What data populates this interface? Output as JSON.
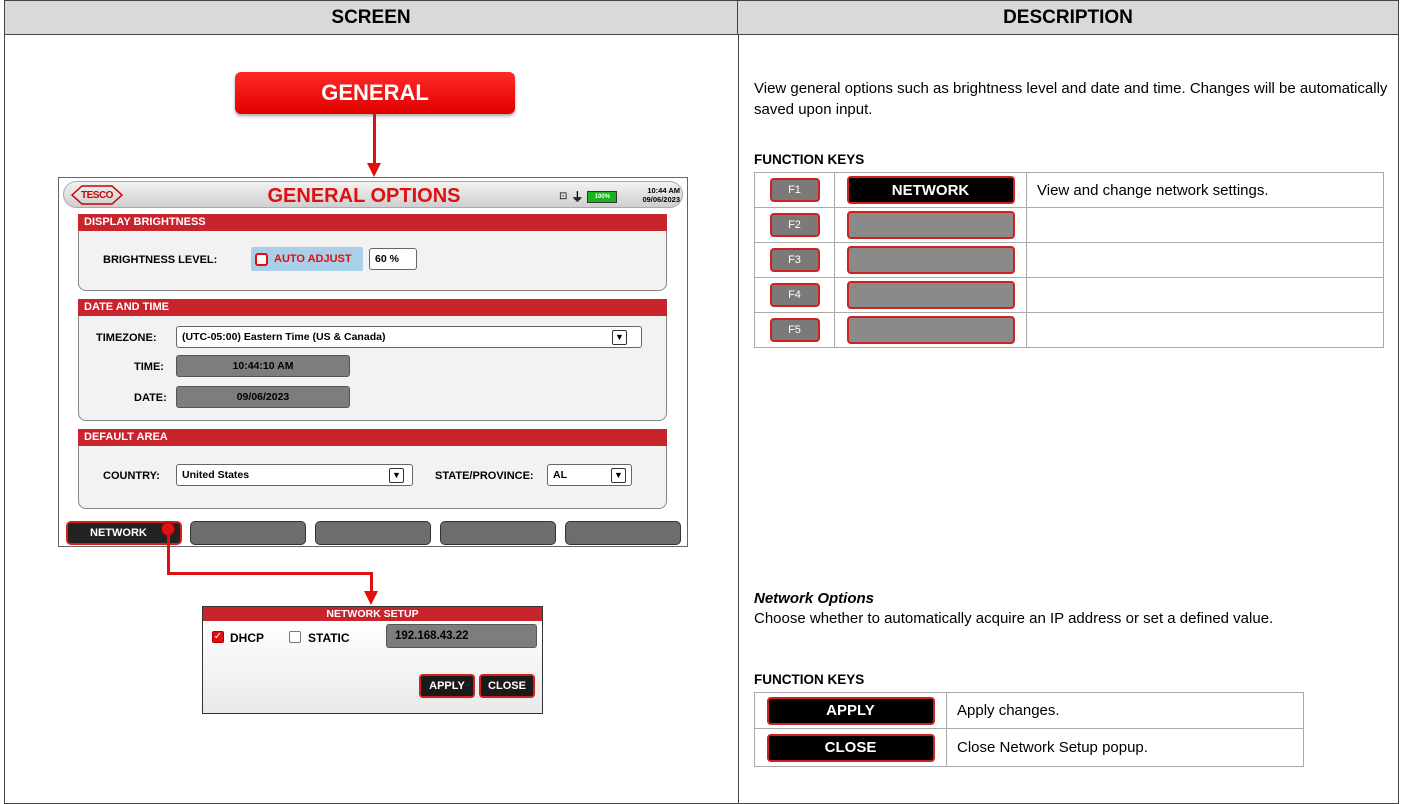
{
  "headers": {
    "screen": "SCREEN",
    "description": "DESCRIPTION"
  },
  "general_callout": "GENERAL",
  "device": {
    "logo": "TESCO",
    "title": "GENERAL OPTIONS",
    "battery": "100%",
    "time": "10:44 AM",
    "date": "09/06/2023",
    "display_brightness": {
      "header": "DISPLAY BRIGHTNESS",
      "label": "BRIGHTNESS LEVEL:",
      "auto_adjust": "AUTO ADJUST",
      "value": "60 %"
    },
    "date_and_time": {
      "header": "DATE AND TIME",
      "timezone_label": "TIMEZONE:",
      "timezone_value": "(UTC-05:00) Eastern Time (US & Canada)",
      "time_label": "TIME:",
      "time_value": "10:44:10 AM",
      "date_label": "DATE:",
      "date_value": "09/06/2023"
    },
    "default_area": {
      "header": "DEFAULT AREA",
      "country_label": "COUNTRY:",
      "country_value": "United States",
      "state_label": "STATE/PROVINCE:",
      "state_value": "AL"
    },
    "function_bar": {
      "f1": "NETWORK"
    }
  },
  "network_popup": {
    "header": "NETWORK SETUP",
    "dhcp": "DHCP",
    "static": "STATIC",
    "ip": "192.168.43.22",
    "apply": "APPLY",
    "close": "CLOSE"
  },
  "description": {
    "intro": "View general options such as brightness level and date and time. Changes will be automatically saved upon input.",
    "function_keys_title": "FUNCTION KEYS",
    "keys": [
      {
        "key": "F1",
        "button": "NETWORK",
        "desc": "View and change network settings."
      },
      {
        "key": "F2",
        "button": "",
        "desc": ""
      },
      {
        "key": "F3",
        "button": "",
        "desc": ""
      },
      {
        "key": "F4",
        "button": "",
        "desc": ""
      },
      {
        "key": "F5",
        "button": "",
        "desc": ""
      }
    ],
    "network_options_title": "Network Options",
    "network_options_text": "Choose whether to automatically acquire an IP address or set a defined value.",
    "function_keys_title_2": "FUNCTION KEYS",
    "popup_keys": [
      {
        "button": "APPLY",
        "desc": "Apply changes."
      },
      {
        "button": "CLOSE",
        "desc": "Close Network Setup popup."
      }
    ]
  }
}
